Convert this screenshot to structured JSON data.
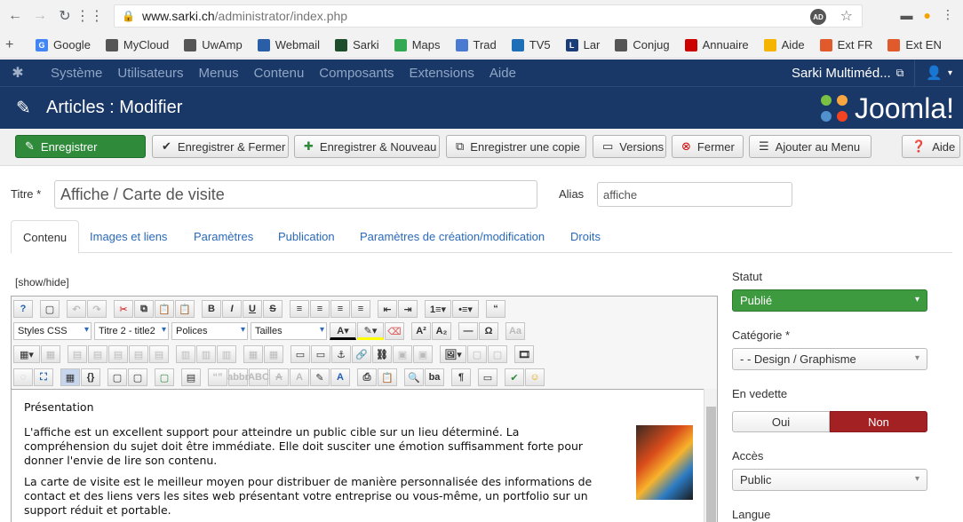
{
  "browser": {
    "url_host": "www.sarki.ch",
    "url_path": "/administrator/index.php",
    "ad_badge": "AD"
  },
  "bookmarks": [
    {
      "label": "Google",
      "color": "#4285f4",
      "glyph": "G"
    },
    {
      "label": "MyCloud",
      "color": "#555555",
      "glyph": ""
    },
    {
      "label": "UwAmp",
      "color": "#555555",
      "glyph": ""
    },
    {
      "label": "Webmail",
      "color": "#2a5fa8",
      "glyph": ""
    },
    {
      "label": "Sarki",
      "color": "#1e4d2b",
      "glyph": ""
    },
    {
      "label": "Maps",
      "color": "#34a853",
      "glyph": ""
    },
    {
      "label": "Trad",
      "color": "#4a7bd0",
      "glyph": ""
    },
    {
      "label": "TV5",
      "color": "#1f6fb8",
      "glyph": ""
    },
    {
      "label": "Lar",
      "color": "#1a3c78",
      "glyph": "L"
    },
    {
      "label": "Conjug",
      "color": "#555555",
      "glyph": ""
    },
    {
      "label": "Annuaire",
      "color": "#cc0000",
      "glyph": ""
    },
    {
      "label": "Aide",
      "color": "#f4b400",
      "glyph": ""
    },
    {
      "label": "Ext FR",
      "color": "#e05a2b",
      "glyph": ""
    },
    {
      "label": "Ext EN",
      "color": "#e05a2b",
      "glyph": ""
    }
  ],
  "admin_nav": {
    "items": [
      "Système",
      "Utilisateurs",
      "Menus",
      "Contenu",
      "Composants",
      "Extensions",
      "Aide"
    ],
    "site_name": "Sarki Multiméd..."
  },
  "header": {
    "title": "Articles : Modifier",
    "brand": "Joomla!"
  },
  "toolbar": {
    "save": "Enregistrer",
    "save_close": "Enregistrer & Fermer",
    "save_new": "Enregistrer & Nouveau",
    "save_copy": "Enregistrer une copie",
    "versions": "Versions",
    "close": "Fermer",
    "add_menu": "Ajouter au Menu",
    "help": "Aide"
  },
  "form": {
    "title_label": "Titre *",
    "title_value": "Affiche / Carte de visite",
    "alias_label": "Alias",
    "alias_value": "affiche"
  },
  "tabs": [
    "Contenu",
    "Images et liens",
    "Paramètres",
    "Publication",
    "Paramètres de création/modification",
    "Droits"
  ],
  "editor": {
    "showhide": "[show/hide]",
    "styles": "Styles CSS",
    "format": "Titre 2 - title2",
    "fonts": "Polices",
    "sizes": "Tailles",
    "heading": "Présentation",
    "paragraphs": [
      "L'affiche est un excellent support pour atteindre un public cible sur un lieu déterminé. La compréhension du sujet doit être immédiate. Elle doit susciter une émotion suffisamment forte pour donner l'envie de lire son contenu.",
      "La carte de visite est le meilleur moyen pour distribuer de manière personnalisée des informations de contact et des liens vers les sites web présentant votre entreprise ou vous-même, un portfolio sur un support réduit et portable."
    ]
  },
  "sidebar": {
    "status_label": "Statut",
    "status_value": "Publié",
    "category_label": "Catégorie *",
    "category_value": "- - Design / Graphisme",
    "featured_label": "En vedette",
    "featured_yes": "Oui",
    "featured_no": "Non",
    "access_label": "Accès",
    "access_value": "Public",
    "language_label": "Langue"
  }
}
